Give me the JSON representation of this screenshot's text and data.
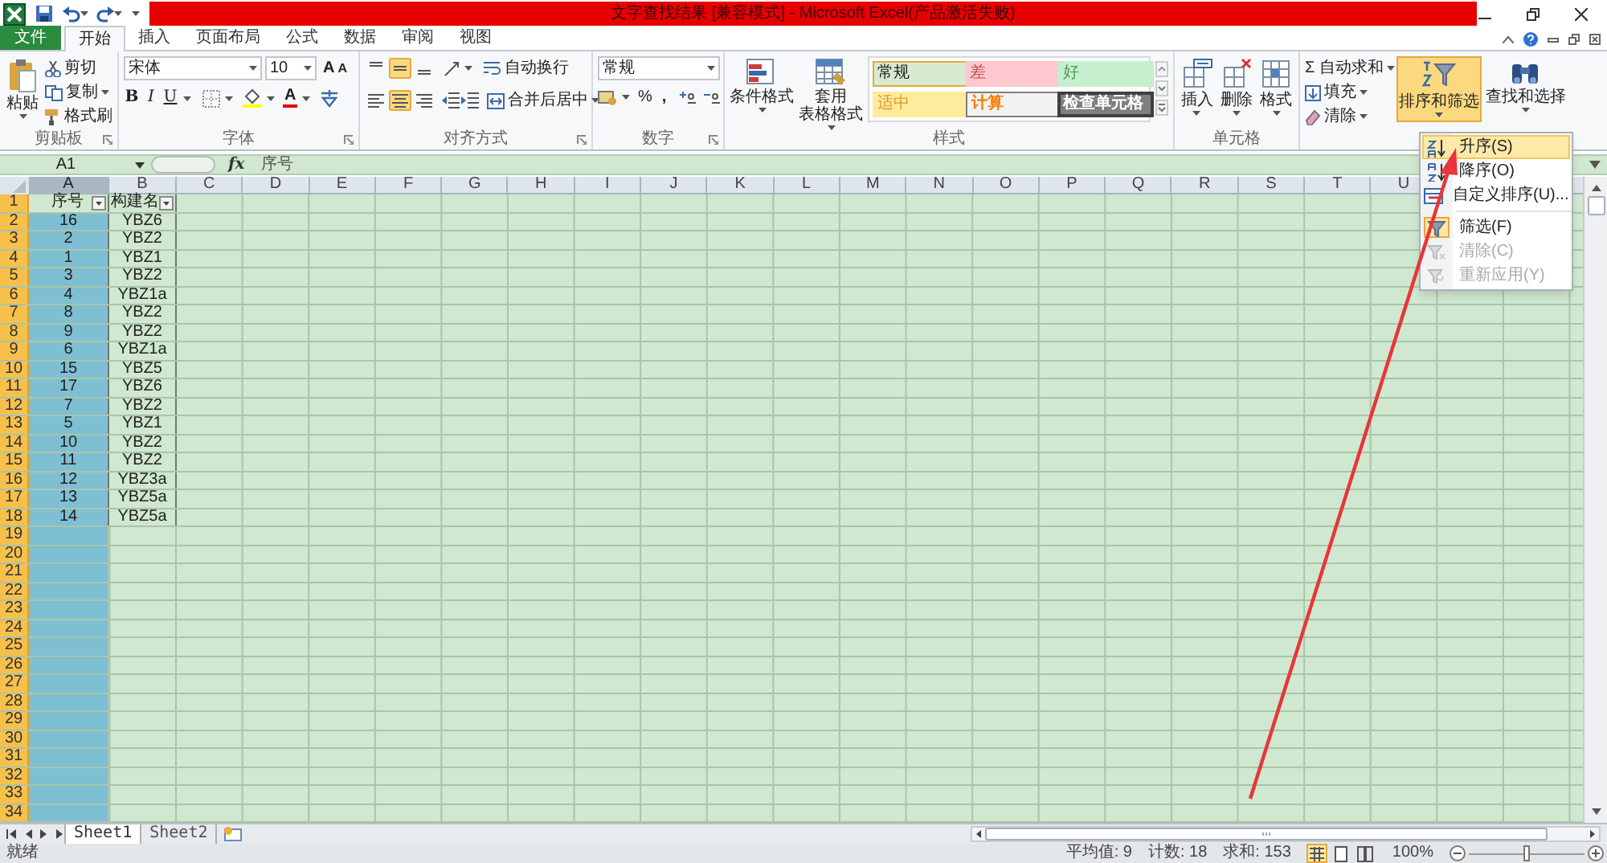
{
  "window": {
    "title": "文字查找结果  [兼容模式] - Microsoft Excel(产品激活失败)"
  },
  "tabs": [
    {
      "label": "文件",
      "kind": "file",
      "selected": false
    },
    {
      "label": "开始",
      "kind": "tab",
      "selected": true
    },
    {
      "label": "插入",
      "kind": "tab",
      "selected": false
    },
    {
      "label": "页面布局",
      "kind": "tab",
      "selected": false
    },
    {
      "label": "公式",
      "kind": "tab",
      "selected": false
    },
    {
      "label": "数据",
      "kind": "tab",
      "selected": false
    },
    {
      "label": "审阅",
      "kind": "tab",
      "selected": false
    },
    {
      "label": "视图",
      "kind": "tab",
      "selected": false
    }
  ],
  "clipboard": {
    "paste": "粘贴",
    "cut": "剪切",
    "copy": "复制",
    "format_painter": "格式刷",
    "label": "剪贴板"
  },
  "font": {
    "name": "宋体",
    "size": "10",
    "grow": "A",
    "shrink": "A",
    "bold": "B",
    "italic": "I",
    "underline": "U",
    "font_color": "A",
    "label": "字体"
  },
  "alignment": {
    "top_row": [
      {
        "selected": false
      },
      {
        "selected": true
      },
      {
        "selected": false
      }
    ],
    "bottom_row": [
      {
        "selected": false
      },
      {
        "selected": true
      },
      {
        "selected": false
      }
    ],
    "wrap": "自动换行",
    "merge": "合并后居中",
    "label": "对齐方式"
  },
  "number": {
    "format": "常规",
    "percent": "%",
    "comma": ",",
    "label": "数字"
  },
  "styles": {
    "conditional": "条件格式",
    "table_format": [
      "套用",
      "表格格式"
    ],
    "label": "样式",
    "cell_styles": [
      {
        "label": "常规",
        "kind": "normal",
        "selected": true
      },
      {
        "label": "差",
        "kind": "bad",
        "selected": false
      },
      {
        "label": "好",
        "kind": "good",
        "selected": false
      },
      {
        "label": "适中",
        "kind": "neutral",
        "selected": false
      },
      {
        "label": "计算",
        "kind": "calculation",
        "selected": false
      },
      {
        "label": "检查单元格",
        "kind": "check",
        "selected": false
      }
    ]
  },
  "cells": {
    "buttons": [
      {
        "label": "插入",
        "kind": "insert"
      },
      {
        "label": "删除",
        "kind": "delete"
      },
      {
        "label": "格式",
        "kind": "format"
      }
    ],
    "label": "单元格"
  },
  "editing": {
    "autosum": "Σ 自动求和",
    "fill": "填充",
    "clear": "清除",
    "sort_filter": {
      "label": "排序和筛选",
      "selected": true
    },
    "find": "查找和选择"
  },
  "sort_menu": {
    "items": [
      {
        "label": "升序(S)",
        "kind": "asc",
        "selected": true,
        "disabled": false,
        "checked": false,
        "separator_before": false
      },
      {
        "label": "降序(O)",
        "kind": "desc",
        "selected": false,
        "disabled": false,
        "checked": false,
        "separator_before": false
      },
      {
        "label": "自定义排序(U)...",
        "kind": "custom",
        "selected": false,
        "disabled": false,
        "checked": false,
        "separator_before": false
      },
      {
        "label": "筛选(F)",
        "kind": "filter",
        "selected": false,
        "disabled": false,
        "checked": true,
        "separator_before": true
      },
      {
        "label": "清除(C)",
        "kind": "clear",
        "selected": false,
        "disabled": true,
        "checked": false,
        "separator_before": false
      },
      {
        "label": "重新应用(Y)",
        "kind": "reapply",
        "selected": false,
        "disabled": true,
        "checked": false,
        "separator_before": false
      }
    ]
  },
  "formula_bar": {
    "name_box": "A1",
    "fx": "fx",
    "content": "序号"
  },
  "sheet": {
    "columns": [
      {
        "label": "A",
        "selected": true
      },
      {
        "label": "B",
        "selected": false
      },
      {
        "label": "C",
        "selected": false
      },
      {
        "label": "D",
        "selected": false
      },
      {
        "label": "E",
        "selected": false
      },
      {
        "label": "F",
        "selected": false
      },
      {
        "label": "G",
        "selected": false
      },
      {
        "label": "H",
        "selected": false
      },
      {
        "label": "I",
        "selected": false
      },
      {
        "label": "J",
        "selected": false
      },
      {
        "label": "K",
        "selected": false
      },
      {
        "label": "L",
        "selected": false
      },
      {
        "label": "M",
        "selected": false
      },
      {
        "label": "N",
        "selected": false
      },
      {
        "label": "O",
        "selected": false
      },
      {
        "label": "P",
        "selected": false
      },
      {
        "label": "Q",
        "selected": false
      },
      {
        "label": "R",
        "selected": false
      },
      {
        "label": "S",
        "selected": false
      },
      {
        "label": "T",
        "selected": false
      },
      {
        "label": "U",
        "selected": false
      }
    ],
    "rows": [
      {
        "header": "1",
        "kind": "header",
        "cells": [
          "序号",
          "构建名"
        ]
      },
      {
        "header": "2",
        "kind": "data",
        "cells": [
          "16",
          "YBZ6"
        ]
      },
      {
        "header": "3",
        "kind": "data",
        "cells": [
          "2",
          "YBZ2"
        ]
      },
      {
        "header": "4",
        "kind": "data",
        "cells": [
          "1",
          "YBZ1"
        ]
      },
      {
        "header": "5",
        "kind": "data",
        "cells": [
          "3",
          "YBZ2"
        ]
      },
      {
        "header": "6",
        "kind": "data",
        "cells": [
          "4",
          "YBZ1a"
        ]
      },
      {
        "header": "7",
        "kind": "data",
        "cells": [
          "8",
          "YBZ2"
        ]
      },
      {
        "header": "8",
        "kind": "data",
        "cells": [
          "9",
          "YBZ2"
        ]
      },
      {
        "header": "9",
        "kind": "data",
        "cells": [
          "6",
          "YBZ1a"
        ]
      },
      {
        "header": "10",
        "kind": "data",
        "cells": [
          "15",
          "YBZ5"
        ]
      },
      {
        "header": "11",
        "kind": "data",
        "cells": [
          "17",
          "YBZ6"
        ]
      },
      {
        "header": "12",
        "kind": "data",
        "cells": [
          "7",
          "YBZ2"
        ]
      },
      {
        "header": "13",
        "kind": "data",
        "cells": [
          "5",
          "YBZ1"
        ]
      },
      {
        "header": "14",
        "kind": "data",
        "cells": [
          "10",
          "YBZ2"
        ]
      },
      {
        "header": "15",
        "kind": "data",
        "cells": [
          "11",
          "YBZ2"
        ]
      },
      {
        "header": "16",
        "kind": "data",
        "cells": [
          "12",
          "YBZ3a"
        ]
      },
      {
        "header": "17",
        "kind": "data",
        "cells": [
          "13",
          "YBZ5a"
        ]
      },
      {
        "header": "18",
        "kind": "data",
        "cells": [
          "14",
          "YBZ5a"
        ]
      },
      {
        "header": "19",
        "kind": "empty"
      },
      {
        "header": "20",
        "kind": "empty"
      },
      {
        "header": "21",
        "kind": "empty"
      },
      {
        "header": "22",
        "kind": "empty"
      },
      {
        "header": "23",
        "kind": "empty"
      },
      {
        "header": "24",
        "kind": "empty"
      },
      {
        "header": "25",
        "kind": "empty"
      },
      {
        "header": "26",
        "kind": "empty"
      },
      {
        "header": "27",
        "kind": "empty"
      },
      {
        "header": "28",
        "kind": "empty"
      },
      {
        "header": "29",
        "kind": "empty"
      },
      {
        "header": "30",
        "kind": "empty"
      },
      {
        "header": "31",
        "kind": "empty"
      },
      {
        "header": "32",
        "kind": "empty"
      },
      {
        "header": "33",
        "kind": "empty"
      },
      {
        "header": "34",
        "kind": "empty"
      }
    ]
  },
  "sheet_tabs": [
    {
      "label": "Sheet1",
      "selected": true
    },
    {
      "label": "Sheet2",
      "selected": false
    }
  ],
  "status_bar": {
    "status": "就绪",
    "average": "平均值: 9",
    "count": "计数: 18",
    "sum": "求和: 153",
    "view_buttons": [
      {
        "selected": true
      },
      {
        "selected": false
      },
      {
        "selected": false
      }
    ],
    "zoom": "100%",
    "zoom_slider": {
      "level": 0.5
    }
  }
}
